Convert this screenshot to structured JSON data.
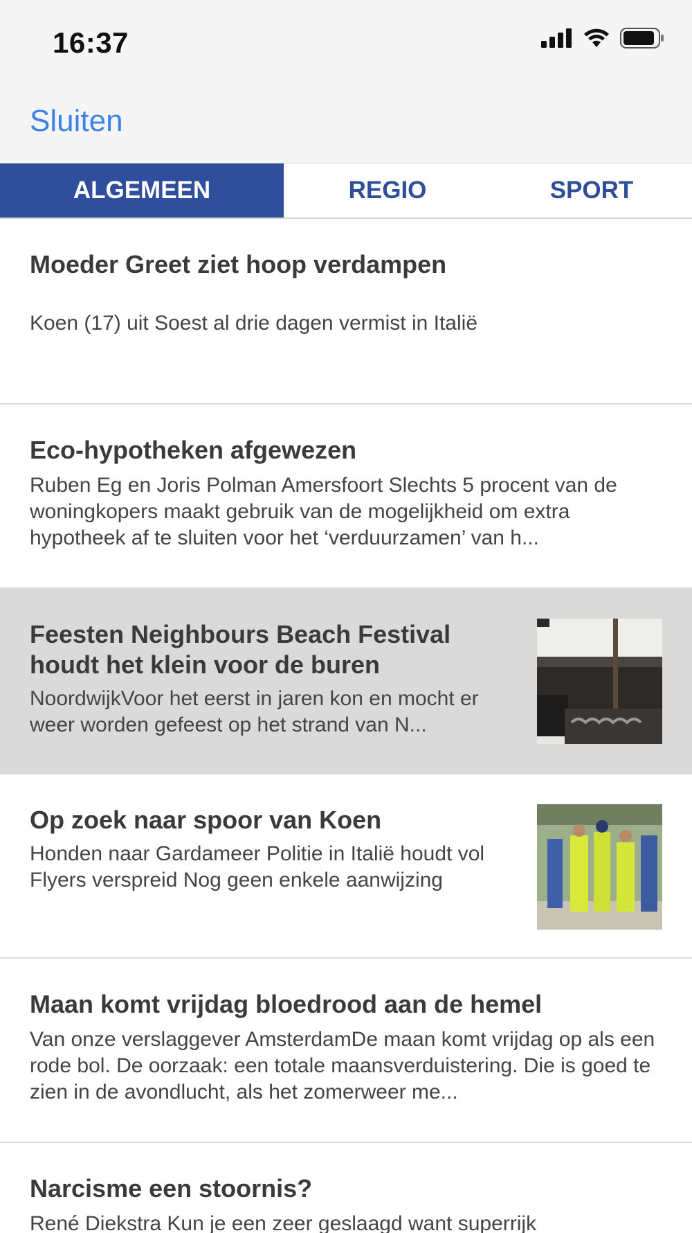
{
  "status_bar": {
    "time": "16:37",
    "icons": [
      "signal-icon",
      "wifi-icon",
      "battery-icon"
    ]
  },
  "nav": {
    "close_label": "Sluiten"
  },
  "tabs": [
    {
      "label": "ALGEMEEN",
      "active": true
    },
    {
      "label": "REGIO",
      "active": false
    },
    {
      "label": "SPORT",
      "active": false
    }
  ],
  "articles": [
    {
      "title": "Moeder Greet ziet hoop verdampen",
      "description": "Koen (17) uit Soest al drie dagen vermist in Italië"
    },
    {
      "title": "Eco-hypotheken afgewezen",
      "description": "Ruben Eg en Joris Polman Amersfoort Slechts 5 procent van de woningkopers maakt gebruik van de mogelijkheid om extra hypotheek af te sluiten voor het ‘verduurzamen’ van h..."
    },
    {
      "title": "Feesten Neighbours Beach Festival houdt het klein voor de buren",
      "description": "NoordwijkVoor het eerst in jaren kon en mocht er weer worden gefeest op het strand van N...",
      "image": "beach-festival-crowd-photo",
      "highlighted": true
    },
    {
      "title": "Op zoek naar spoor van Koen",
      "description": "Honden naar Gardameer Politie in Italië houdt vol Flyers verspreid Nog geen enkele aanwijzing",
      "image": "search-team-photo"
    },
    {
      "title": "Maan komt vrijdag bloedrood aan de hemel",
      "description": "Van onze verslaggever AmsterdamDe maan komt vrijdag op als een rode bol. De oorzaak: een totale maansverduistering. Die is goed te zien in de avondlucht, als het zomerweer me..."
    },
    {
      "title": "Narcisme een stoornis?",
      "description": "René Diekstra Kun je een zeer geslaagd want superrijk"
    }
  ],
  "colors": {
    "accent": "#3d82e8",
    "tab_active_bg": "#2f4f9c",
    "tab_text": "#2f4d99",
    "highlight_bg": "#dadada"
  }
}
